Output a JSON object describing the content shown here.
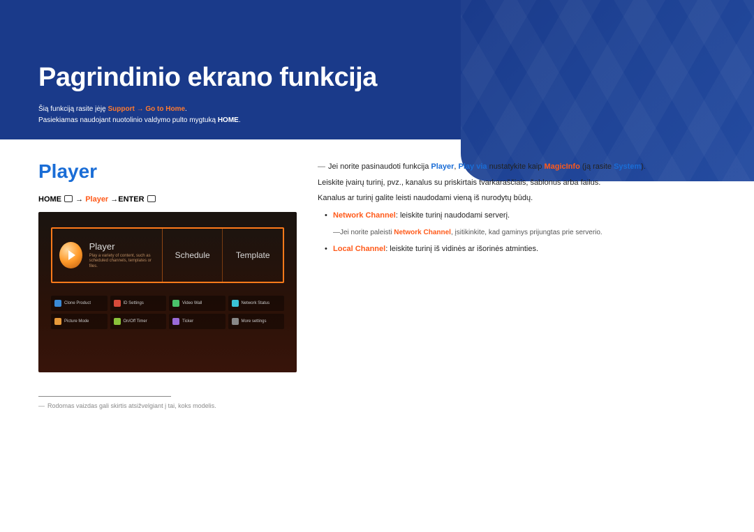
{
  "header": {
    "title": "Pagrindinio ekrano funkcija",
    "intro_prefix": "Šią funkciją rasite įėję ",
    "intro_hl": "Support → Go to Home",
    "intro_suffix": ".",
    "intro_line2_prefix": "Pasiekiamas naudojant nuotolinio valdymo pulto mygtuką ",
    "intro_line2_strong": "HOME",
    "intro_line2_suffix": "."
  },
  "section": {
    "title": "Player",
    "breadcrumb_home": "HOME ",
    "breadcrumb_arrow1": " → ",
    "breadcrumb_player": "Player",
    "breadcrumb_arrow2": " →",
    "breadcrumb_enter": "ENTER "
  },
  "device": {
    "player_title": "Player",
    "player_sub": "Play a variety of content, such as scheduled channels, templates or files.",
    "schedule": "Schedule",
    "template": "Template",
    "grid": [
      {
        "label": "Clone Product",
        "cls": "c-blue"
      },
      {
        "label": "ID Settings",
        "cls": "c-red"
      },
      {
        "label": "Video Wall",
        "cls": "c-green"
      },
      {
        "label": "Network Status",
        "cls": "c-cyan"
      },
      {
        "label": "Picture Mode",
        "cls": "c-orange"
      },
      {
        "label": "On/Off Timer",
        "cls": "c-lime"
      },
      {
        "label": "Ticker",
        "cls": "c-purple"
      },
      {
        "label": "More settings",
        "cls": "c-grey"
      }
    ]
  },
  "footnote": "Rodomas vaizdas gali skirtis atsižvelgiant į tai, koks modelis.",
  "right": {
    "note_prefix": "Jei norite pasinaudoti funkcija ",
    "note_player": "Player",
    "note_mid1": ", ",
    "note_playvia": "Play via",
    "note_mid2": " nustatykite kaip ",
    "note_magicinfo": "MagicInfo",
    "note_mid3": " (ją rasite ",
    "note_system": "System",
    "note_suffix": ").",
    "line2": "Leiskite įvairų turinį, pvz., kanalus su priskirtais tvarkaraščiais, šablonus arba failus.",
    "line3": "Kanalus ar turinį galite leisti naudodami vieną iš nurodytų būdų.",
    "bullet1_hl": "Network Channel",
    "bullet1_rest": ": leiskite turinį naudodami serverį.",
    "subnote_prefix": "Jei norite paleisti ",
    "subnote_hl": "Network Channel",
    "subnote_rest": ", įsitikinkite, kad gaminys prijungtas prie serverio.",
    "bullet2_hl": "Local Channel",
    "bullet2_rest": ": leiskite turinį iš vidinės ar išorinės atminties."
  }
}
